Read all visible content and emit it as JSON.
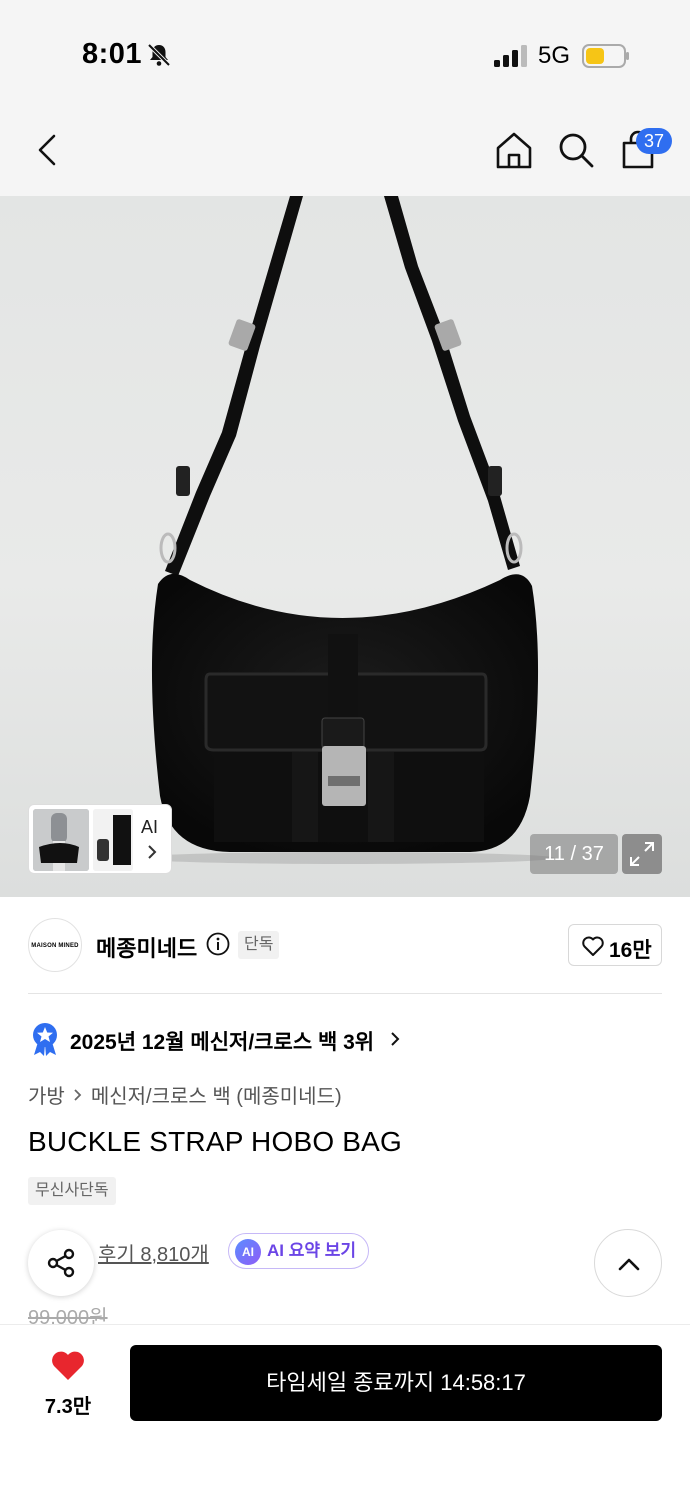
{
  "status_bar": {
    "time": "8:01",
    "network": "5G"
  },
  "nav": {
    "cart_count": "37"
  },
  "gallery": {
    "ai_label": "AI",
    "current": "11 / 37"
  },
  "brand": {
    "logo_text": "MAISON MINED",
    "name": "메종미네드",
    "badge": "단독",
    "likes": "16만"
  },
  "ranking": {
    "text": "2025년 12월 메신저/크로스 백 3위"
  },
  "breadcrumb": {
    "category": "가방",
    "subcategory": "메신저/크로스 백 (메종미네드)"
  },
  "product": {
    "title": "BUCKLE STRAP HOBO BAG",
    "exclusive_tag": "무신사단독",
    "review_link": "후기 8,810개",
    "ai_summary": "AI 요약 보기",
    "ai_badge": "AI",
    "original_price": "99,000원"
  },
  "bottom": {
    "wish_count": "7.3만",
    "buy_label": "타임세일 종료까지 14:58:17"
  },
  "colors": {
    "accent": "#2f6ef0",
    "heart": "#e8262e",
    "ai_purple": "#6b45e6"
  }
}
